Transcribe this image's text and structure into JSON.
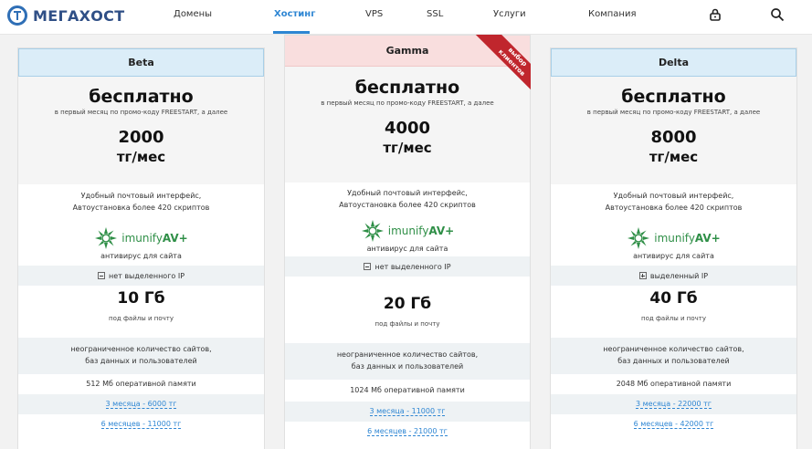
{
  "header": {
    "logo_text": "МЕГАХОСТ",
    "nav": [
      "Домены",
      "Хостинг",
      "VPS",
      "SSL",
      "Услуги",
      "Компания"
    ],
    "active_nav": "Хостинг"
  },
  "ribbon": {
    "line1": "выбор",
    "line2": "клиентов"
  },
  "plans": [
    {
      "name": "Beta",
      "free": "бесплатно",
      "promo": "в первый месяц по промо-коду FREESTART, а далее",
      "amount": "2000",
      "unit": "тг/мес",
      "feature_line1": "Удобный почтовый интерфейс,",
      "feature_line2": "Автоустановка более 420 скриптов",
      "imunify_brand": "imunify",
      "imunify_suffix": "AV+",
      "av_label": "антивирус для сайта",
      "ip": "нет выделенного IP",
      "disk": "10 Гб",
      "disk_sub": "под файлы и почту",
      "sites_line1": "неограниченное количество сайтов,",
      "sites_line2": "баз данных и пользователей",
      "ram": "512 Мб оперативной памяти",
      "term1": "3 месяца - 6000 тг",
      "term2": "6 месяцев - 11000 тг"
    },
    {
      "name": "Gamma",
      "free": "бесплатно",
      "promo": "в первый месяц по промо-коду FREESTART, а далее",
      "amount": "4000",
      "unit": "тг/мес",
      "feature_line1": "Удобный почтовый интерфейс,",
      "feature_line2": "Автоустановка более 420 скриптов",
      "imunify_brand": "imunify",
      "imunify_suffix": "AV+",
      "av_label": "антивирус для сайта",
      "ip": "нет выделенного IP",
      "disk": "20 Гб",
      "disk_sub": "под файлы и почту",
      "sites_line1": "неограниченное количество сайтов,",
      "sites_line2": "баз данных и пользователей",
      "ram": "1024 Мб оперативной памяти",
      "term1": "3 месяца - 11000 тг",
      "term2": "6 месяцев - 21000 тг"
    },
    {
      "name": "Delta",
      "free": "бесплатно",
      "promo": "в первый месяц по промо-коду FREESTART, а далее",
      "amount": "8000",
      "unit": "тг/мес",
      "feature_line1": "Удобный почтовый интерфейс,",
      "feature_line2": "Автоустановка более 420 скриптов",
      "imunify_brand": "imunify",
      "imunify_suffix": "AV+",
      "av_label": "антивирус для сайта",
      "ip": "выделенный IP",
      "disk": "40 Гб",
      "disk_sub": "под файлы и почту",
      "sites_line1": "неограниченное количество сайтов,",
      "sites_line2": "баз данных и пользователей",
      "ram": "2048 Мб оперативной памяти",
      "term1": "3 месяца - 22000 тг",
      "term2": "6 месяцев - 42000 тг"
    }
  ],
  "colors": {
    "accent": "#2e86d3",
    "brand": "#2f4f86",
    "ribbon": "#c0262d",
    "imunify": "#2f8f47"
  }
}
